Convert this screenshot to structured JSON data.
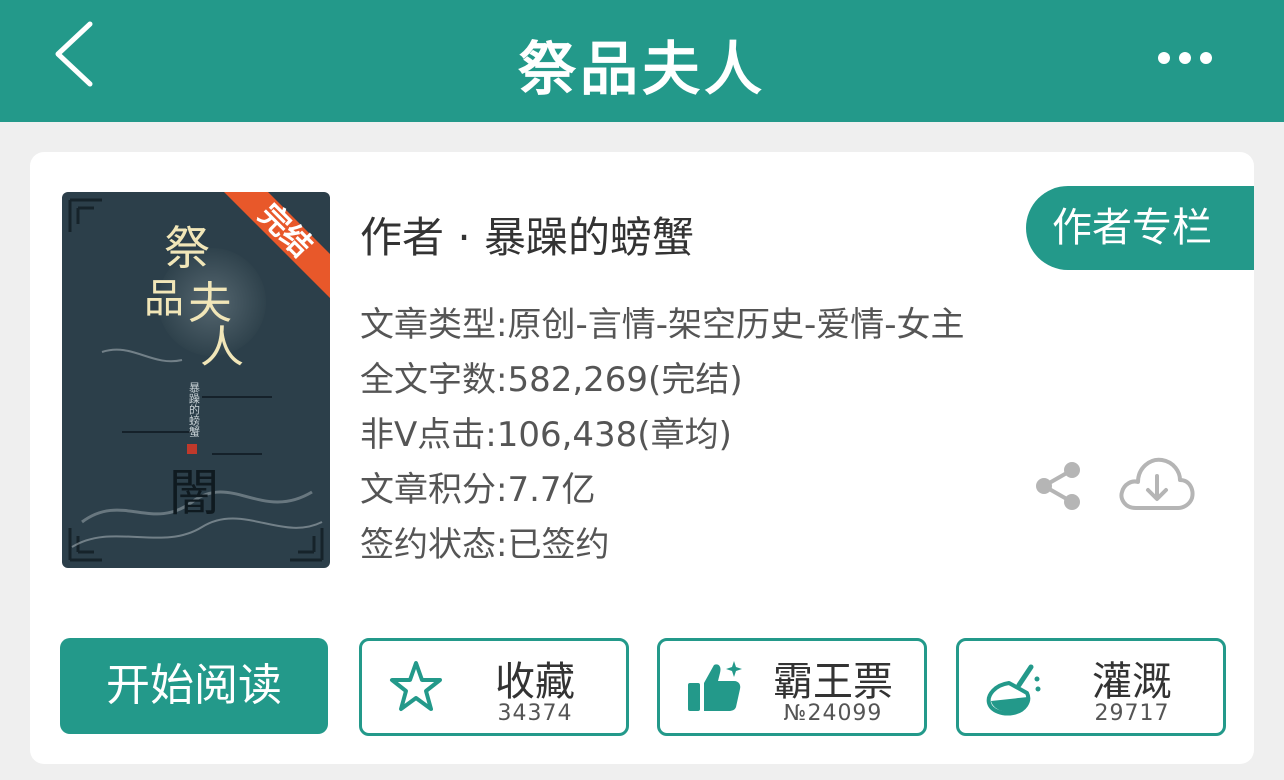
{
  "header": {
    "title": "祭品夫人"
  },
  "book": {
    "cover_title": "祭品夫人",
    "cover_badge": "完结",
    "cover_seal": "闇",
    "cover_author_small": "暴躁的螃蟹",
    "author_line": "作者 · 暴躁的螃蟹",
    "author_column_label": "作者专栏",
    "meta": [
      "文章类型:原创-言情-架空历史-爱情-女主",
      "全文字数:582,269(完结)",
      "非Ⅴ点击:106,438(章均)",
      "文章积分:7.7亿",
      "签约状态:已签约"
    ]
  },
  "actions": {
    "read_label": "开始阅读",
    "favorite": {
      "label": "收藏",
      "count": "34374",
      "icon": "star-icon"
    },
    "bawang": {
      "label": "霸王票",
      "count": "№24099",
      "icon": "thumbs-up-icon"
    },
    "nutrient": {
      "label": "灌溉",
      "count": "29717",
      "icon": "flask-icon"
    }
  },
  "icons": {
    "back": "chevron-left-icon",
    "more": "more-dots-icon",
    "share": "share-icon",
    "download": "cloud-download-icon"
  },
  "colors": {
    "brand": "#23998a",
    "badge": "#e8582a",
    "cover_bg": "#2c3f4a"
  }
}
